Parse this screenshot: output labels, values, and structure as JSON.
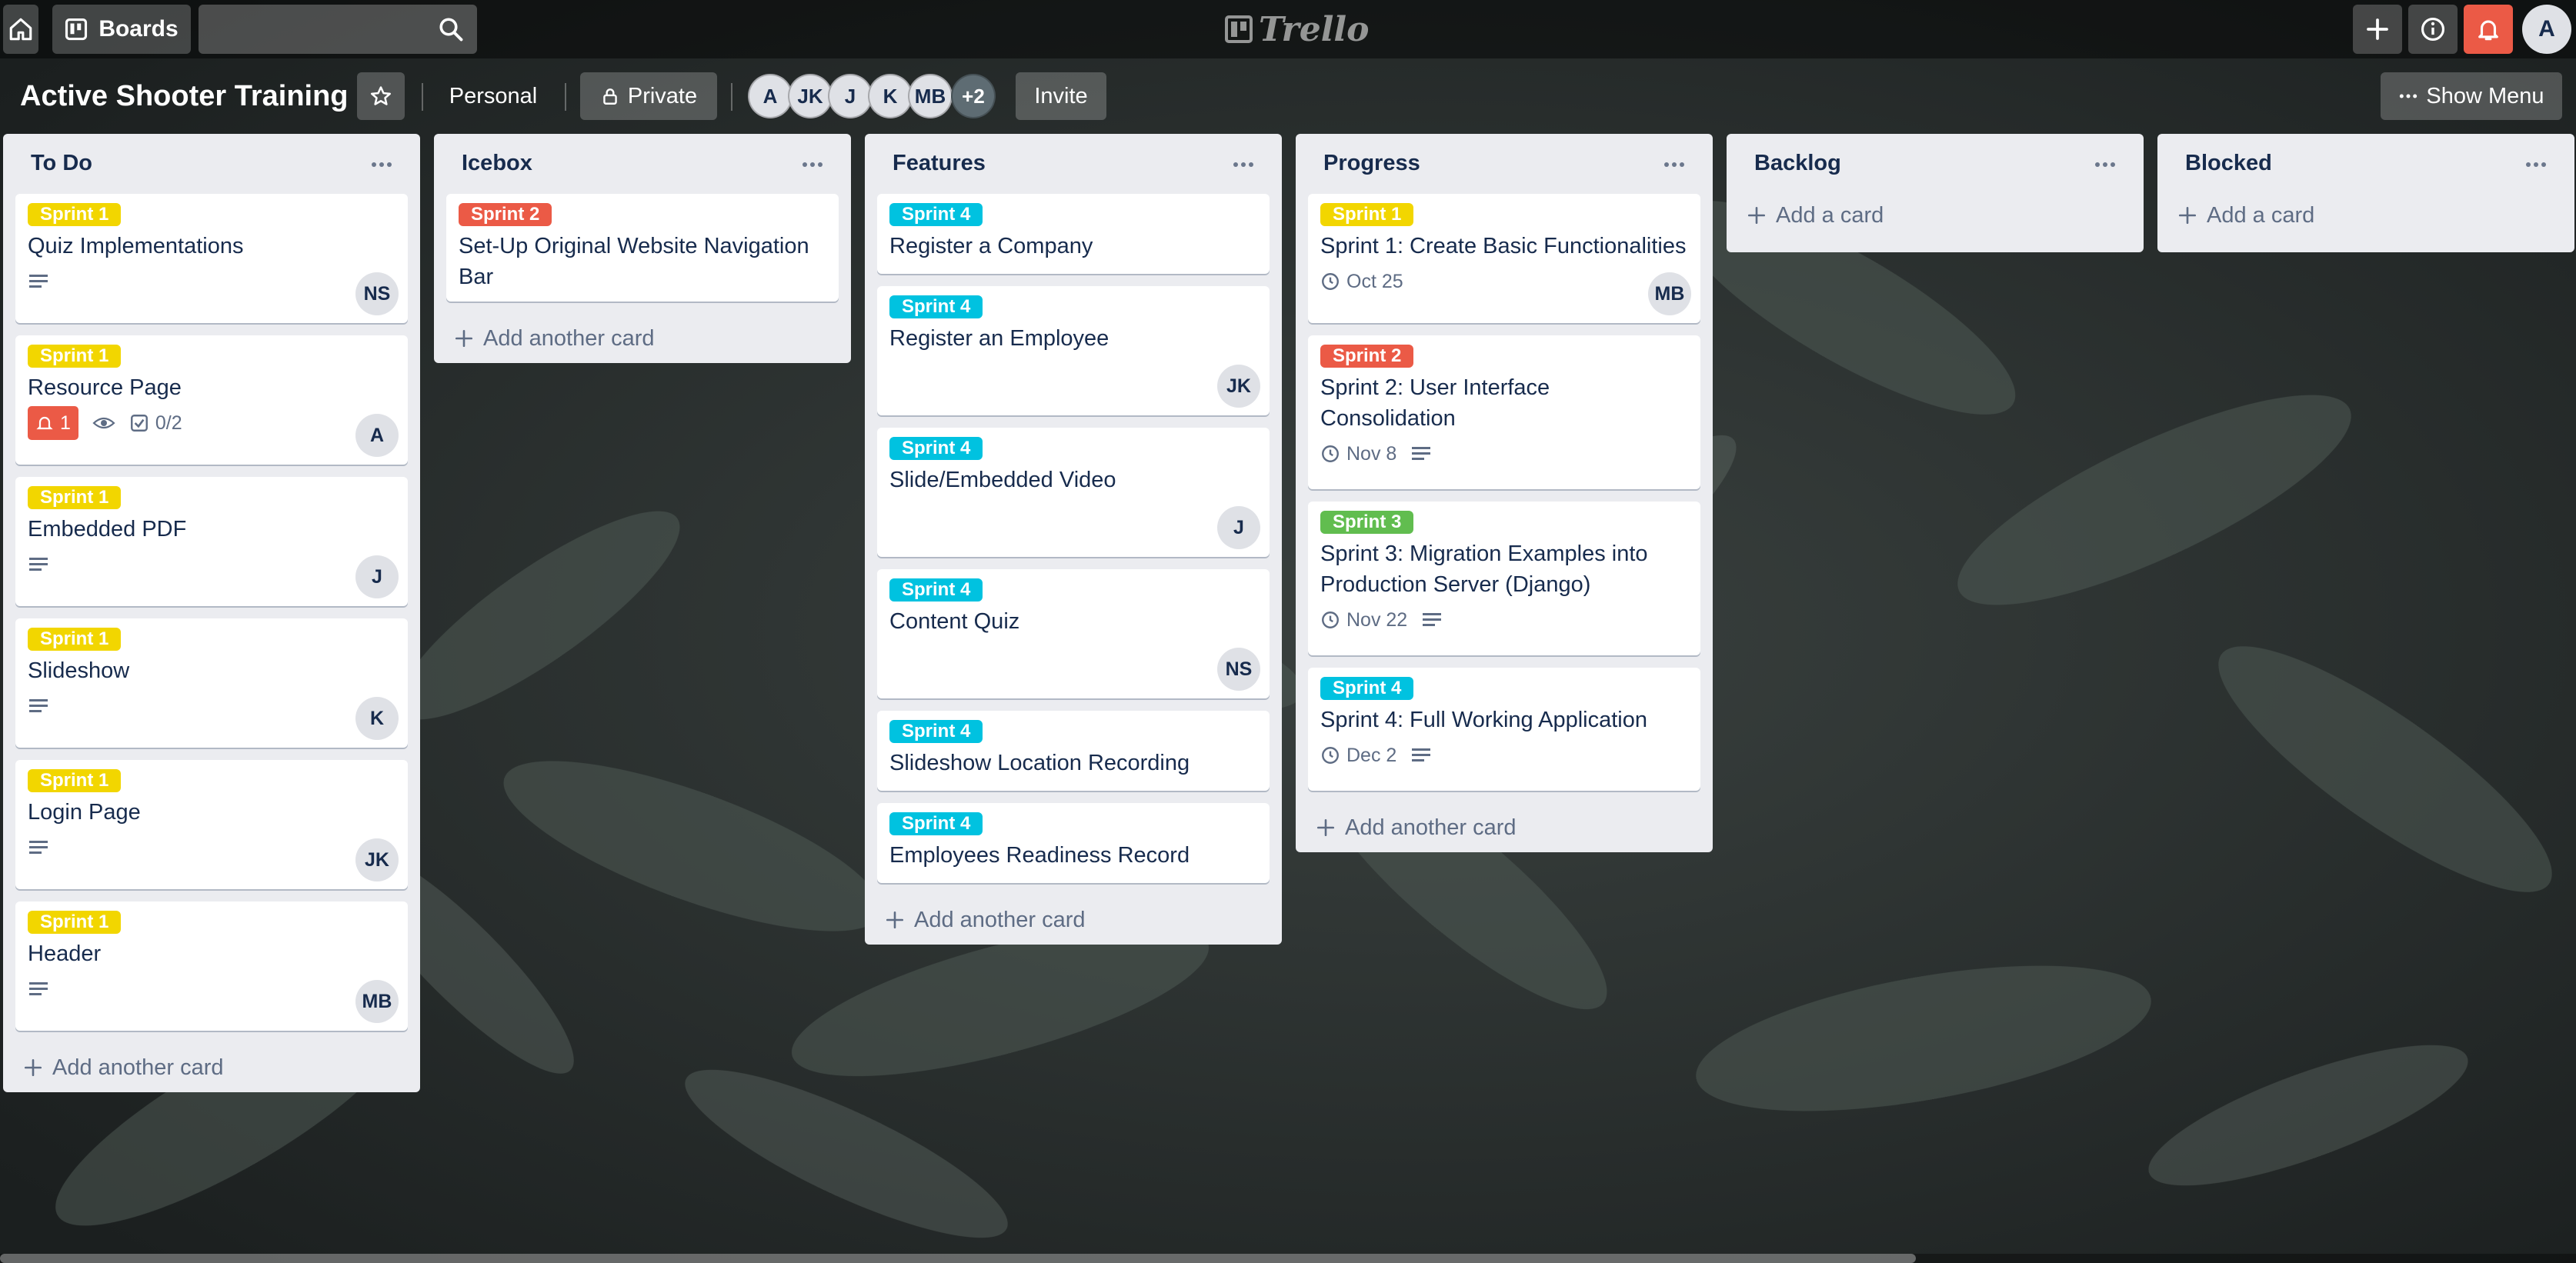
{
  "header": {
    "boards_label": "Boards",
    "logo_text": "Trello",
    "user_initial": "A"
  },
  "board": {
    "title": "Active Shooter Training",
    "visibility_team": "Personal",
    "visibility_private": "Private",
    "members": [
      "A",
      "JK",
      "J",
      "K",
      "MB"
    ],
    "members_more": "+2",
    "invite_label": "Invite",
    "show_menu_label": "Show Menu"
  },
  "lists": [
    {
      "title": "To Do",
      "add_label": "Add another card",
      "cards": [
        {
          "label": "Sprint 1",
          "title": "Quiz Implementations",
          "member": "NS"
        },
        {
          "label": "Sprint 1",
          "title": "Resource Page",
          "member": "A",
          "notifications": "1",
          "checklist": "0/2"
        },
        {
          "label": "Sprint 1",
          "title": "Embedded PDF",
          "member": "J"
        },
        {
          "label": "Sprint 1",
          "title": "Slideshow",
          "member": "K"
        },
        {
          "label": "Sprint 1",
          "title": "Login Page",
          "member": "JK"
        },
        {
          "label": "Sprint 1",
          "title": "Header",
          "member": "MB"
        }
      ]
    },
    {
      "title": "Icebox",
      "add_label": "Add another card",
      "cards": [
        {
          "label": "Sprint 2",
          "title": "Set-Up Original Website Navigation Bar"
        }
      ]
    },
    {
      "title": "Features",
      "add_label": "Add another card",
      "cards": [
        {
          "label": "Sprint 4",
          "title": "Register a Company"
        },
        {
          "label": "Sprint 4",
          "title": "Register an Employee",
          "member": "JK"
        },
        {
          "label": "Sprint 4",
          "title": "Slide/Embedded Video",
          "member": "J"
        },
        {
          "label": "Sprint 4",
          "title": "Content Quiz",
          "member": "NS"
        },
        {
          "label": "Sprint 4",
          "title": "Slideshow Location Recording"
        },
        {
          "label": "Sprint 4",
          "title": "Employees Readiness Record"
        }
      ]
    },
    {
      "title": "Progress",
      "add_label": "Add another card",
      "cards": [
        {
          "label": "Sprint 1",
          "title": "Sprint 1: Create Basic Functionalities",
          "due": "Oct 25",
          "member": "MB"
        },
        {
          "label": "Sprint 2",
          "title": "Sprint 2: User Interface Consolidation",
          "due": "Nov 8"
        },
        {
          "label": "Sprint 3",
          "title": "Sprint 3: Migration Examples into Production Server (Django)",
          "due": "Nov 22"
        },
        {
          "label": "Sprint 4",
          "title": "Sprint 4: Full Working Application",
          "due": "Dec 2"
        }
      ]
    },
    {
      "title": "Backlog",
      "add_label": "Add a card",
      "cards": []
    },
    {
      "title": "Blocked",
      "add_label": "Add a card",
      "cards": []
    }
  ],
  "label_colors": {
    "Sprint 1": "#f2d600",
    "Sprint 2": "#eb5a46",
    "Sprint 3": "#61bd4f",
    "Sprint 4": "#00c2e0"
  },
  "icons": [
    "home-icon",
    "boards-icon",
    "search-icon",
    "plus-icon",
    "info-icon",
    "bell-icon",
    "star-icon",
    "lock-icon",
    "ellipsis-icon",
    "description-icon",
    "eye-icon",
    "checklist-icon",
    "clock-icon"
  ]
}
